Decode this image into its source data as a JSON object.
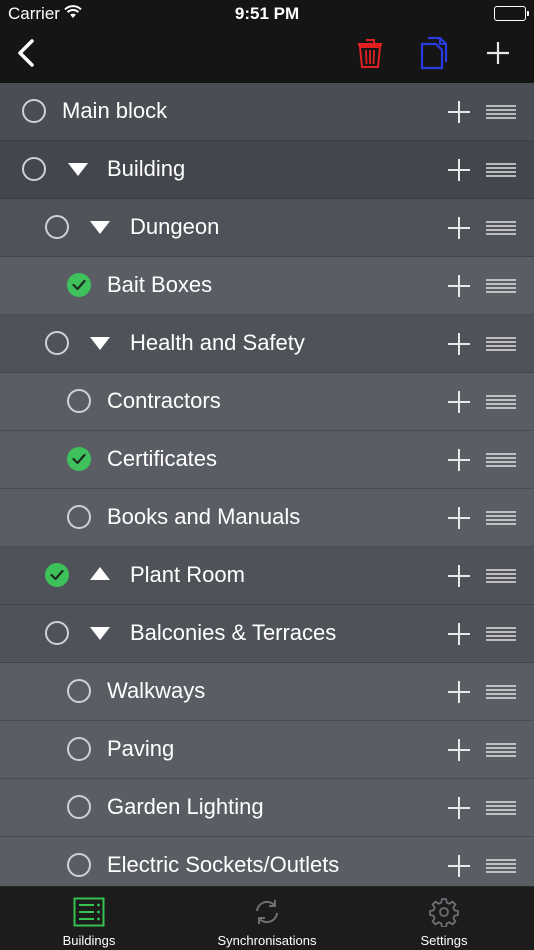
{
  "status_bar": {
    "carrier": "Carrier",
    "time": "9:51 PM",
    "battery_level": 1.0
  },
  "nav": {
    "back_icon": "chevron-left-icon",
    "trash_icon": "trash-icon",
    "copy_icon": "copy-icon",
    "add_icon": "plus-icon",
    "trash_color": "#e02020",
    "copy_color": "#2a3be0"
  },
  "rows": [
    {
      "label": "Main block",
      "level": 0,
      "checked": false,
      "expander": "none"
    },
    {
      "label": "Building",
      "level": 1,
      "checked": false,
      "expander": "down"
    },
    {
      "label": "Dungeon",
      "level": 2,
      "checked": false,
      "expander": "down"
    },
    {
      "label": "Bait Boxes",
      "level": 3,
      "checked": true,
      "expander": "none"
    },
    {
      "label": "Health and Safety",
      "level": 2,
      "checked": false,
      "expander": "down"
    },
    {
      "label": "Contractors",
      "level": 3,
      "checked": false,
      "expander": "none"
    },
    {
      "label": "Certificates",
      "level": 3,
      "checked": true,
      "expander": "none"
    },
    {
      "label": "Books and Manuals",
      "level": 3,
      "checked": false,
      "expander": "none"
    },
    {
      "label": "Plant Room",
      "level": 2,
      "checked": true,
      "expander": "up"
    },
    {
      "label": "Balconies & Terraces",
      "level": 2,
      "checked": false,
      "expander": "down"
    },
    {
      "label": "Walkways",
      "level": 3,
      "checked": false,
      "expander": "none"
    },
    {
      "label": "Paving",
      "level": 3,
      "checked": false,
      "expander": "none"
    },
    {
      "label": "Garden Lighting",
      "level": 3,
      "checked": false,
      "expander": "none"
    },
    {
      "label": "Electric Sockets/Outlets",
      "level": 3,
      "checked": false,
      "expander": "none"
    }
  ],
  "tabs": {
    "buildings": {
      "label": "Buildings",
      "icon": "list-icon",
      "active": true
    },
    "sync": {
      "label": "Synchronisations",
      "icon": "sync-icon",
      "active": false
    },
    "settings": {
      "label": "Settings",
      "icon": "gear-icon",
      "active": false
    }
  },
  "colors": {
    "active_tab": "#35c24f",
    "inactive_tab": "#6c6f73",
    "check_on": "#3ec15a"
  }
}
